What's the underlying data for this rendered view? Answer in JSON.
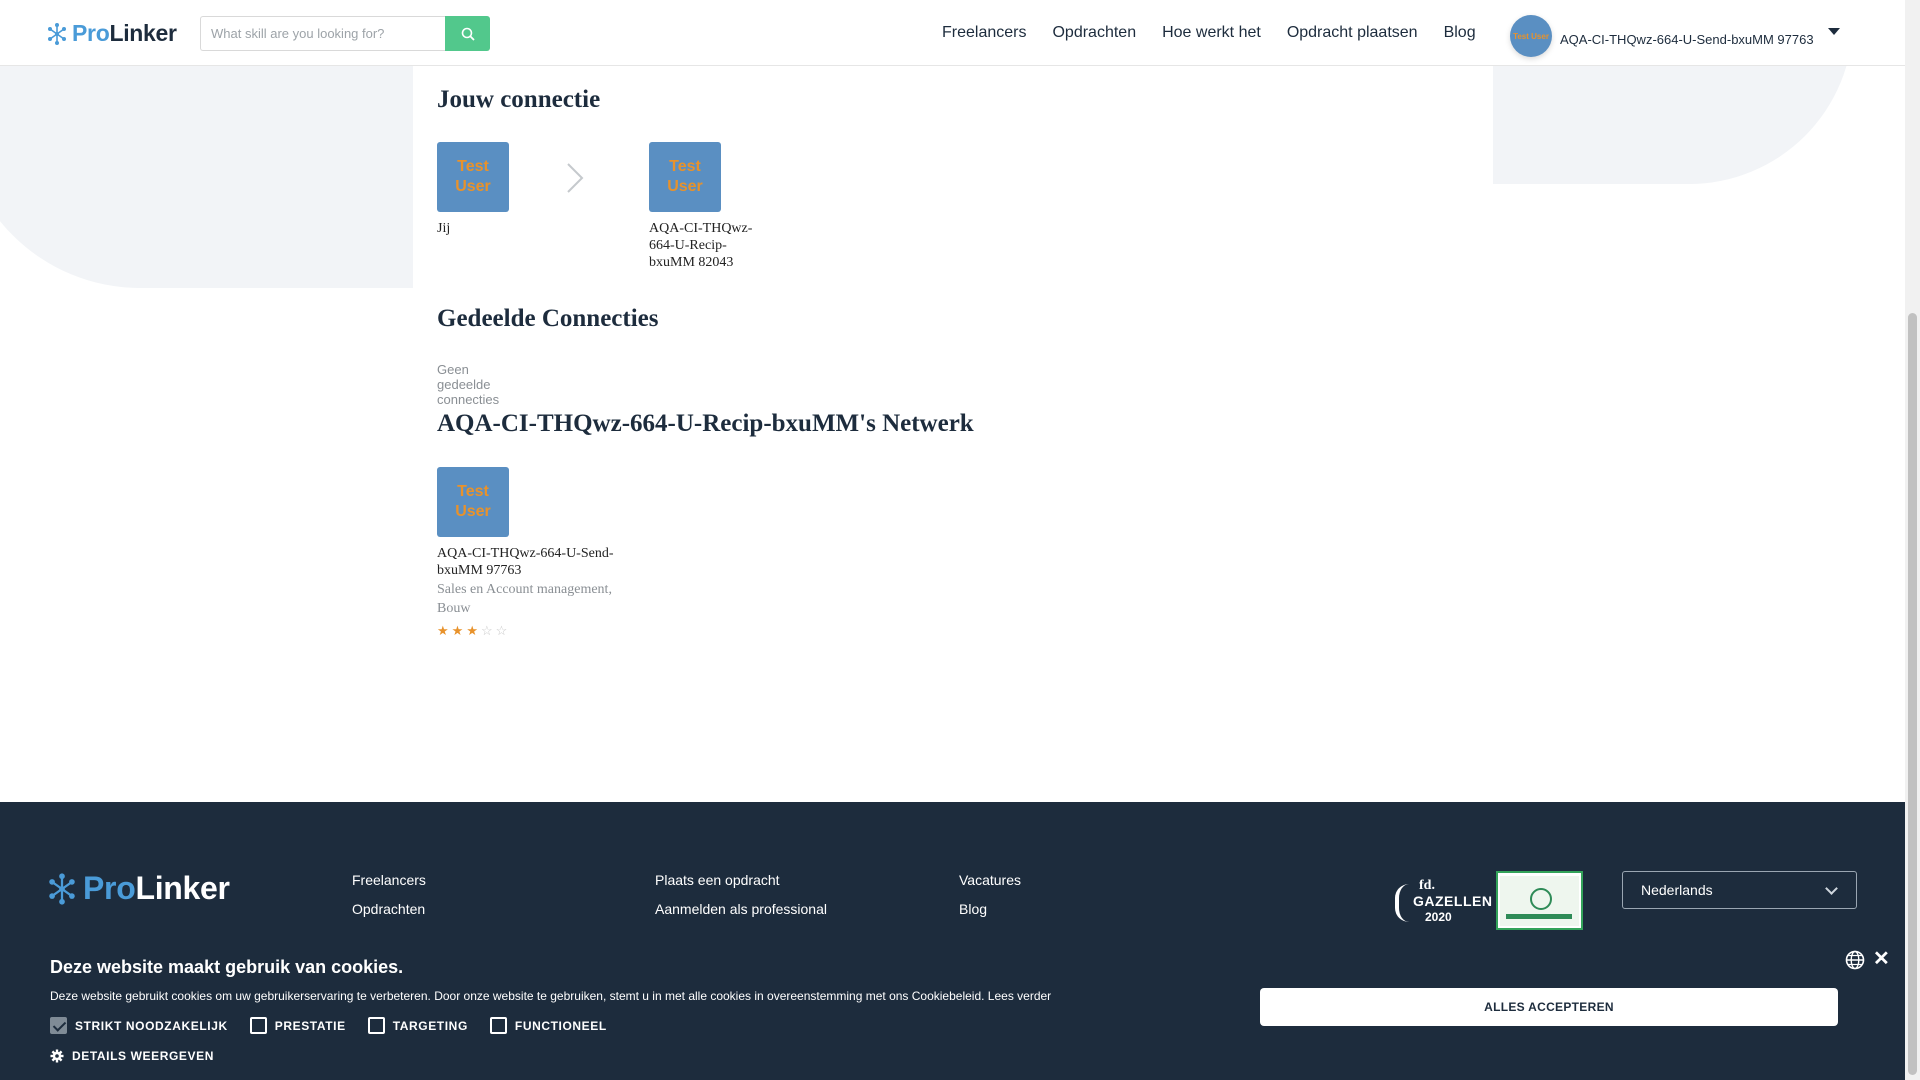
{
  "header": {
    "logo": {
      "part1": "Pro",
      "part2": "Linker"
    },
    "search": {
      "placeholder": "What skill are you looking for?"
    },
    "nav": [
      "Freelancers",
      "Opdrachten",
      "Hoe werkt het",
      "Opdracht plaatsen",
      "Blog"
    ],
    "user": {
      "name": "AQA-CI-THQwz-664-U-Send-bxuMM 97763",
      "avatar_text": "Test User"
    }
  },
  "connection": {
    "title": "Jouw connectie",
    "avatar_line1": "Test",
    "avatar_line2": "User",
    "you_label": "Jij",
    "other_name": "AQA-CI-THQwz-664-U-Recip-bxuMM 82043"
  },
  "shared": {
    "title": "Gedeelde Connecties",
    "empty_text": "Geen gedeelde connecties"
  },
  "network": {
    "title": "AQA-CI-THQwz-664-U-Recip-bxuMM's Netwerk",
    "members": [
      {
        "avatar_line1": "Test",
        "avatar_line2": "User",
        "name": "AQA-CI-THQwz-664-U-Send-bxuMM 97763",
        "skills": "Sales en Account management, Bouw",
        "rating": 3,
        "rating_max": 5
      }
    ]
  },
  "footer": {
    "logo": {
      "part1": "Pro",
      "part2": "Linker"
    },
    "col1": [
      "Freelancers",
      "Opdrachten"
    ],
    "col2": [
      "Plaats een opdracht",
      "Aanmelden als professional"
    ],
    "col3": [
      "Vacatures",
      "Blog"
    ],
    "gazellen": {
      "brand": "fd.",
      "name": "GAZELLEN",
      "year": "2020"
    },
    "language": "Nederlands"
  },
  "cookie": {
    "title": "Deze website maakt gebruik van cookies.",
    "text": "Deze website gebruikt cookies om uw gebruikerservaring te verbeteren. Door onze website te gebruiken, stemt u in met alle cookies in overeenstemming met ons Cookiebeleid. Lees verder",
    "options": [
      {
        "label": "STRIKT NOODZAKELIJK",
        "checked": true
      },
      {
        "label": "PRESTATIE",
        "checked": false
      },
      {
        "label": "TARGETING",
        "checked": false
      },
      {
        "label": "FUNCTIONEEL",
        "checked": false
      }
    ],
    "details": "DETAILS WEERGEVEN",
    "accept": "ALLES ACCEPTEREN"
  },
  "colors": {
    "brand_blue": "#4a9bd8",
    "navy": "#1d2c3d",
    "search_green": "#52c88c",
    "avatar_blue": "#5a8fc2",
    "star_orange": "#e8922b"
  }
}
